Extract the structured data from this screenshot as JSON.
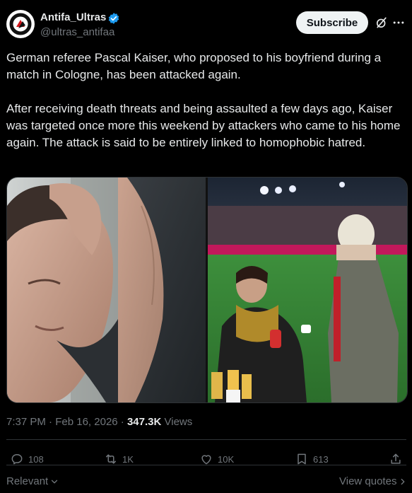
{
  "author": {
    "name": "Antifa_Ultras",
    "handle": "@ultras_antifaa",
    "verified": true
  },
  "header": {
    "subscribe_label": "Subscribe",
    "grok_icon": "grok-icon",
    "more_icon": "more-icon"
  },
  "post": {
    "paragraph1": "German referee Pascal Kaiser, who proposed to his boyfriend during a match in Cologne, has been attacked again.",
    "paragraph2": "After receiving death threats and being assaulted a few days ago, Kaiser was targeted once more this weekend by attackers who came to his home again. The attack is said to be entirely linked to homophobic hatred."
  },
  "meta": {
    "time": "7:37 PM",
    "separator": " · ",
    "date": "Feb 16, 2026",
    "views_count": "347.3K",
    "views_label": " Views"
  },
  "actions": {
    "replies": "108",
    "reposts": "1K",
    "likes": "10K",
    "bookmarks": "613"
  },
  "footer": {
    "relevant_label": "Relevant",
    "view_quotes_label": "View quotes"
  },
  "colors": {
    "background": "#000000",
    "text": "#e7e9ea",
    "muted": "#71767b",
    "verified": "#1d9bf0",
    "border": "#2f3336"
  }
}
